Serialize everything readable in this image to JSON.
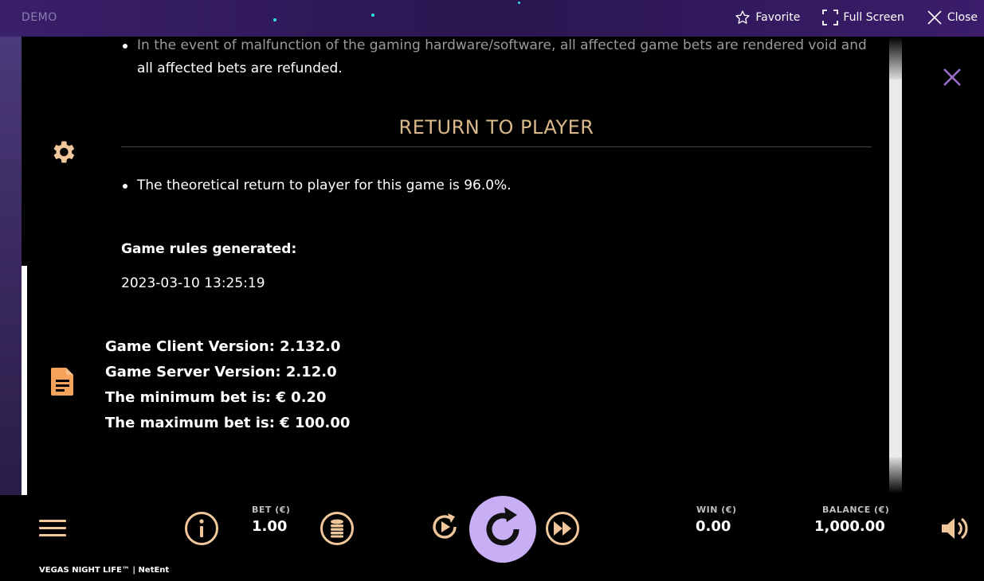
{
  "topbar": {
    "mode_label": "DEMO",
    "favorite_label": "Favorite",
    "fullscreen_label": "Full Screen",
    "close_label": "Close"
  },
  "rules": {
    "malfunction_line1": "In the event of malfunction of the gaming hardware/software, all affected game bets are rendered void and",
    "malfunction_line2": "all affected bets are refunded.",
    "rtp_title": "RETURN TO PLAYER",
    "rtp_text": "The theoretical return to player for this game is 96.0%.",
    "generated_label": "Game rules generated:",
    "generated_value": "2023-03-10 13:25:19",
    "client_version": "Game Client Version: 2.132.0",
    "server_version": "Game Server Version: 2.12.0",
    "min_bet": "The minimum bet is: € 0.20",
    "max_bet": "The maximum bet is: € 100.00"
  },
  "bottombar": {
    "bet_label": "BET (€)",
    "bet_value": "1.00",
    "win_label": "WIN (€)",
    "win_value": "0.00",
    "balance_label": "BALANCE (€)",
    "balance_value": "1,000.00",
    "brand": "VEGAS NIGHT LIFE™  |  NetEnt"
  },
  "colors": {
    "accent_gold": "#d9b98a",
    "icon_orange": "#f5a25a",
    "spin_purple": "#c8aef5",
    "close_purple": "#9b6fc9"
  },
  "icons": [
    "star-icon",
    "fullscreen-icon",
    "close-icon",
    "gear-icon",
    "document-icon",
    "menu-icon",
    "info-icon",
    "coins-icon",
    "autoplay-icon",
    "spin-icon",
    "turbo-icon",
    "sound-icon"
  ]
}
